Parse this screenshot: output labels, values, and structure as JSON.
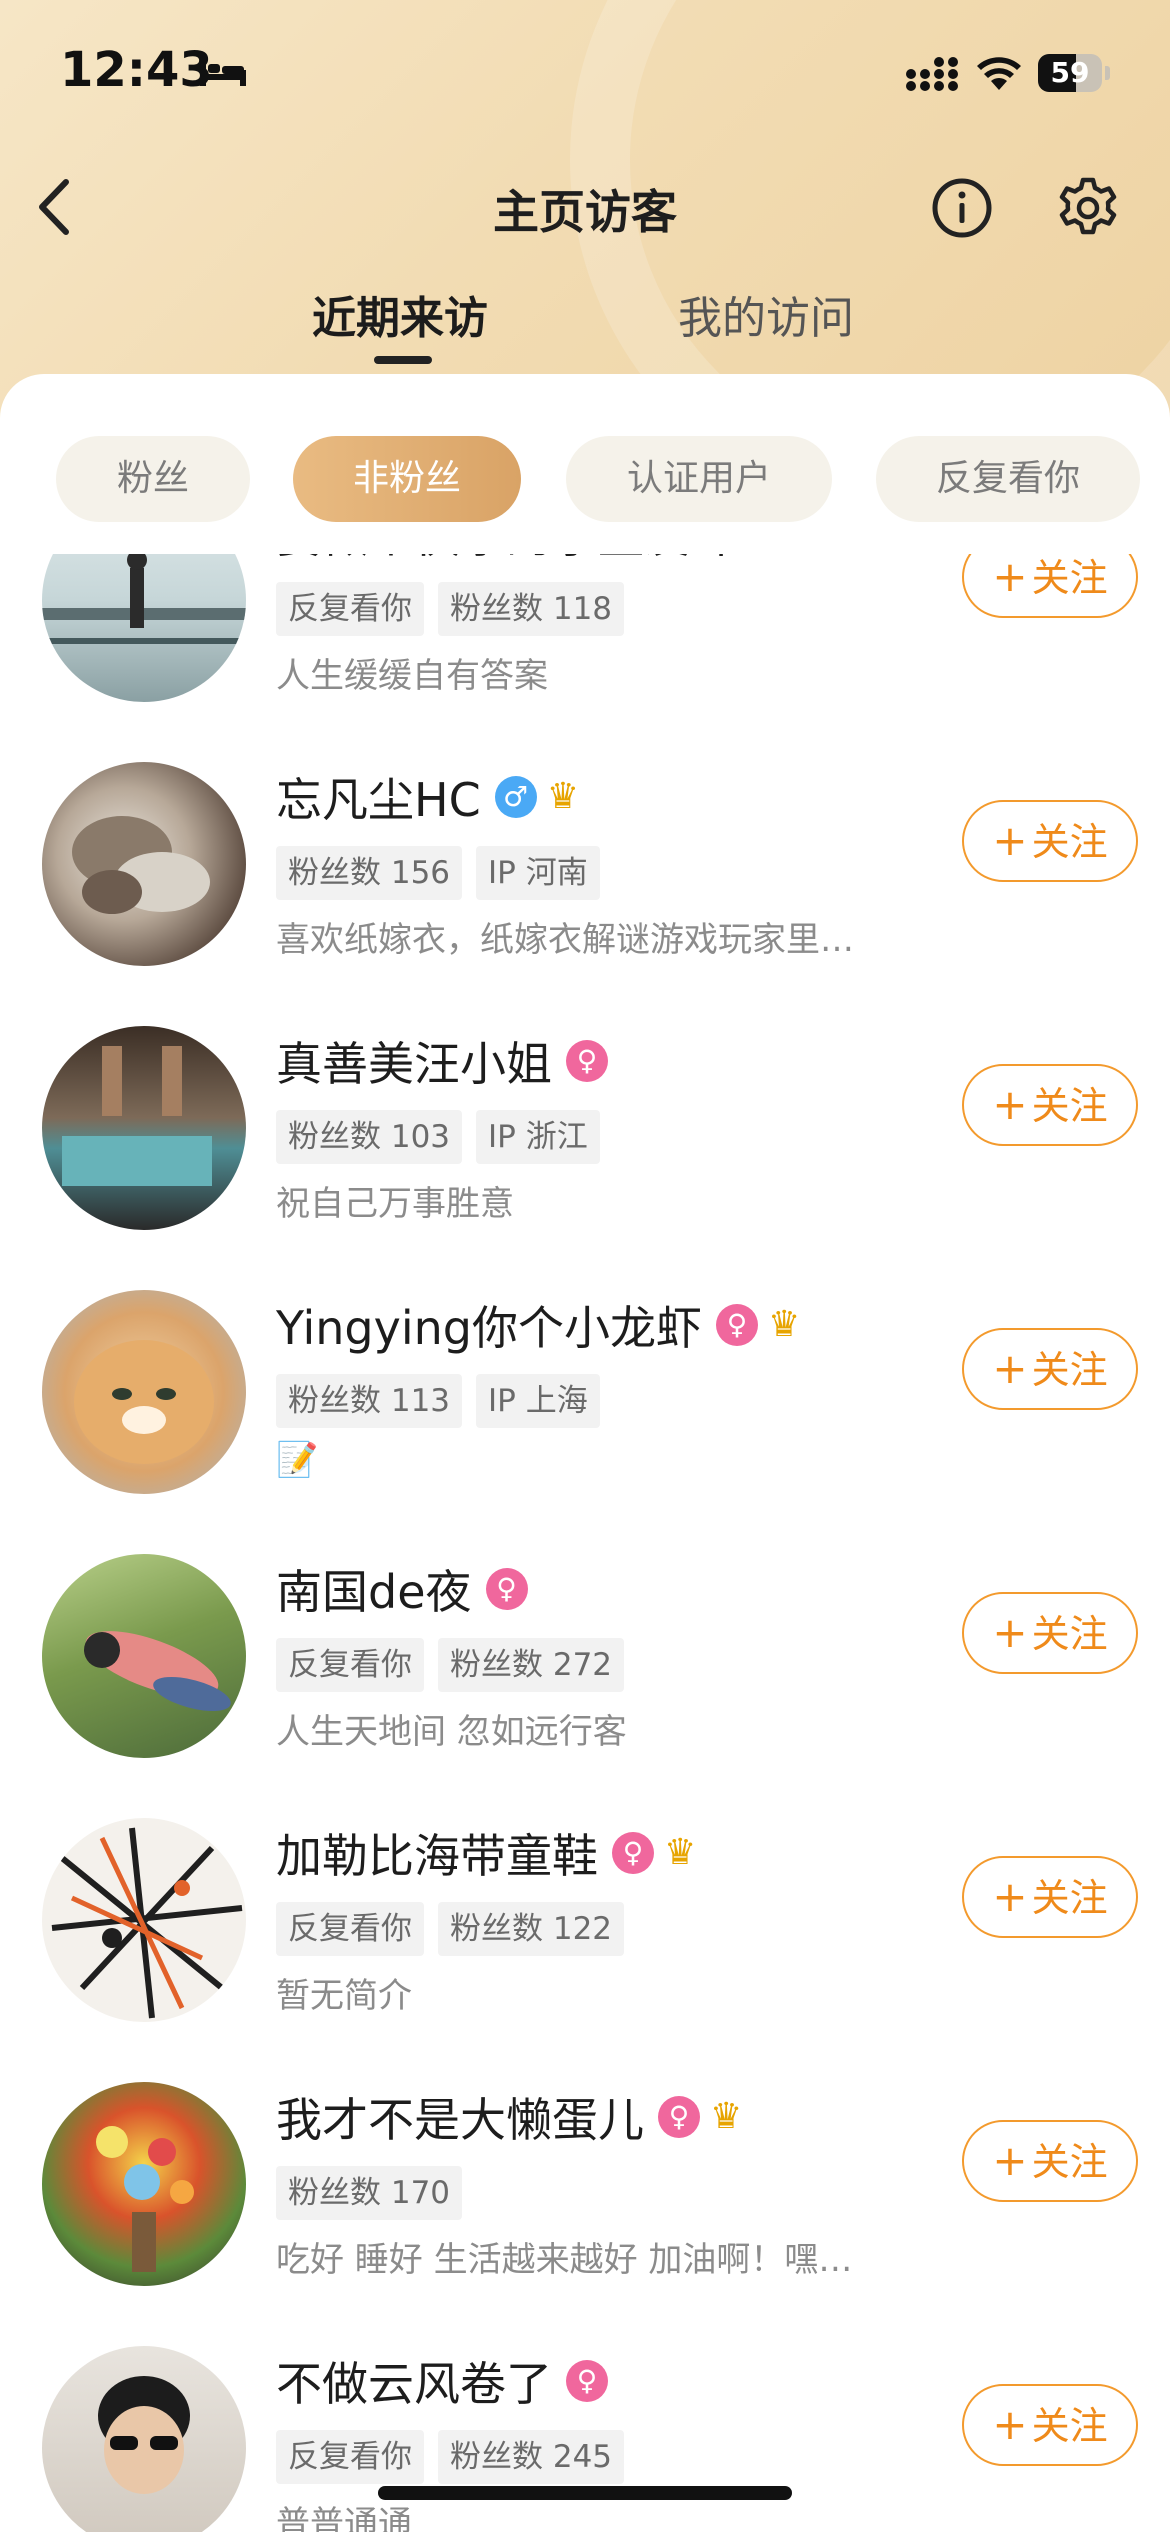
{
  "status_bar": {
    "time": "12:43",
    "battery": 59
  },
  "header": {
    "title": "主页访客"
  },
  "tabs": [
    {
      "label": "近期来访",
      "active": true
    },
    {
      "label": "我的访问",
      "active": false
    }
  ],
  "filters": [
    {
      "label": "粉丝",
      "active": false
    },
    {
      "label": "非粉丝",
      "active": true
    },
    {
      "label": "认证用户",
      "active": false
    },
    {
      "label": "反复看你",
      "active": false
    }
  ],
  "follow_label": "关注",
  "follow_plus": "+",
  "visitors": [
    {
      "name": "要做个快乐的小盆友吖",
      "gender": "♀",
      "crown": false,
      "tags": [
        "反复看你",
        "粉丝数 118"
      ],
      "bio": "人生缓缓自有答案"
    },
    {
      "name": "忘凡尘HC",
      "gender": "♂",
      "crown": true,
      "tags": [
        "粉丝数 156",
        "IP 河南"
      ],
      "bio": "喜欢纸嫁衣，纸嫁衣解谜游戏玩家里…"
    },
    {
      "name": "真善美汪小姐",
      "gender": "♀",
      "crown": false,
      "tags": [
        "粉丝数 103",
        "IP 浙江"
      ],
      "bio": "祝自己万事胜意"
    },
    {
      "name": "Yingying你个小龙虾",
      "gender": "♀",
      "crown": true,
      "tags": [
        "粉丝数 113",
        "IP 上海"
      ],
      "bio": "📝"
    },
    {
      "name": "南国de夜",
      "gender": "♀",
      "crown": false,
      "tags": [
        "反复看你",
        "粉丝数 272"
      ],
      "bio": "人生天地间 忽如远行客"
    },
    {
      "name": "加勒比海带童鞋",
      "gender": "♀",
      "crown": true,
      "tags": [
        "反复看你",
        "粉丝数 122"
      ],
      "bio": "暂无简介"
    },
    {
      "name": "我才不是大懒蛋儿",
      "gender": "♀",
      "crown": true,
      "tags": [
        "粉丝数 170"
      ],
      "bio": "吃好 睡好 生活越来越好 加油啊！嘿…"
    },
    {
      "name": "不做云风卷了",
      "gender": "♀",
      "crown": false,
      "tags": [
        "反复看你",
        "粉丝数 245"
      ],
      "bio": "普普通通"
    }
  ],
  "colors": {
    "accent": "#ef8a1a",
    "chip_active": "#dba76a",
    "female": "#f0679d",
    "male": "#4aa9f5"
  }
}
